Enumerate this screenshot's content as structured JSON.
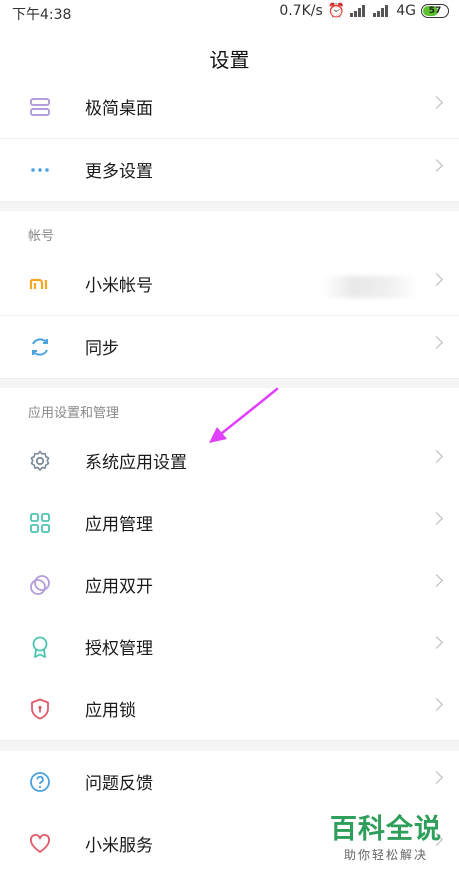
{
  "status_bar": {
    "time": "下午4:38",
    "network_speed": "0.7K/s",
    "network_type": "4G",
    "battery": "57"
  },
  "header": {
    "title": "设置"
  },
  "colors": {
    "accent_green": "#2e9e5b",
    "arrow_magenta": "#e040fb",
    "icon_purple": "#b39ddb",
    "icon_orange": "#f5a623",
    "icon_blue": "#4aa3df",
    "icon_teal": "#4cc4b0",
    "icon_red": "#e05a6a"
  },
  "group1": {
    "items": [
      {
        "label": "极简桌面",
        "icon": "minimal-desktop-icon"
      },
      {
        "label": "更多设置",
        "icon": "more-dots-icon"
      }
    ]
  },
  "account": {
    "header": "帐号",
    "items": [
      {
        "label": "小米帐号",
        "icon": "mi-logo-icon"
      },
      {
        "label": "同步",
        "icon": "sync-icon"
      }
    ]
  },
  "apps": {
    "header": "应用设置和管理",
    "items": [
      {
        "label": "系统应用设置",
        "icon": "gear-icon"
      },
      {
        "label": "应用管理",
        "icon": "grid-icon"
      },
      {
        "label": "应用双开",
        "icon": "dual-circle-icon"
      },
      {
        "label": "授权管理",
        "icon": "badge-icon"
      },
      {
        "label": "应用锁",
        "icon": "shield-icon"
      }
    ]
  },
  "support": {
    "items": [
      {
        "label": "问题反馈",
        "icon": "question-icon"
      },
      {
        "label": "小米服务",
        "icon": "heart-icon"
      }
    ]
  },
  "watermark": {
    "title": "百科全说",
    "subtitle": "助你轻松解决"
  }
}
